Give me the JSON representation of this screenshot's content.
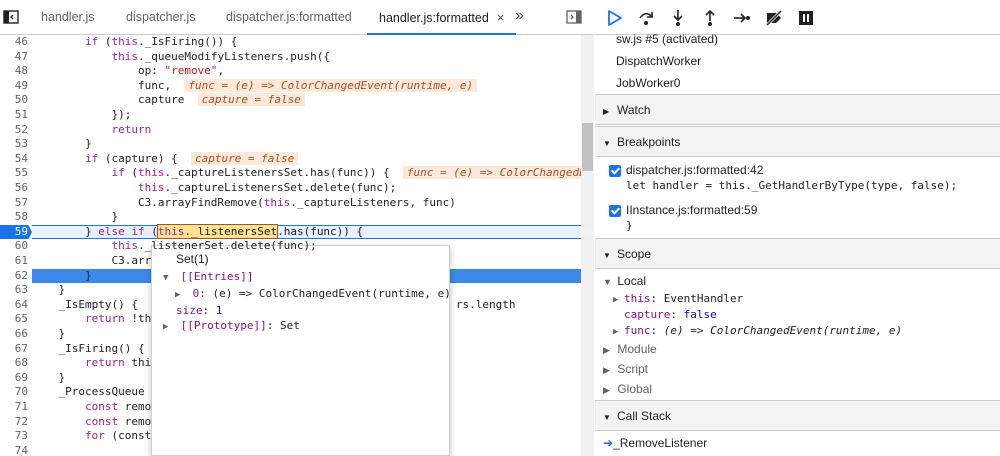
{
  "tabs": [
    {
      "label": "handler.js"
    },
    {
      "label": "dispatcher.js"
    },
    {
      "label": "dispatcher.js:formatted"
    },
    {
      "label": "handler.js:formatted",
      "active": true,
      "close": "×"
    }
  ],
  "more_tabs_glyph": "»",
  "code": {
    "active_line": 59,
    "lines": [
      {
        "n": "46",
        "html": "        <span class=\"kw\">if</span> (<span class=\"kw\">this</span>._IsFiring()) {"
      },
      {
        "n": "47",
        "html": "            <span class=\"kw\">this</span>._queueModifyListeners.push({"
      },
      {
        "n": "48",
        "html": "                op: <span class=\"str\">\"remove\"</span>,"
      },
      {
        "n": "49",
        "html": "                func,  <span class=\"inline-val\">func = (e) =&gt; ColorChangedEvent(runtime, e)</span>"
      },
      {
        "n": "50",
        "html": "                capture  <span class=\"inline-val\">capture = false</span>"
      },
      {
        "n": "51",
        "html": "            });"
      },
      {
        "n": "52",
        "html": "            <span class=\"kw\">return</span>"
      },
      {
        "n": "53",
        "html": "        }"
      },
      {
        "n": "54",
        "html": "        <span class=\"kw\">if</span> (capture) {  <span class=\"inline-val\">capture = false</span>"
      },
      {
        "n": "55",
        "html": "            <span class=\"kw\">if</span> (<span class=\"kw\">this</span>._captureListenersSet.has(func)) {  <span class=\"inline-val\">func = (e) =&gt; ColorChangedEvent(runtime, e)</span>"
      },
      {
        "n": "56",
        "html": "                <span class=\"kw\">this</span>._captureListenersSet.delete(func);"
      },
      {
        "n": "57",
        "html": "                C3.arrayFindRemove(<span class=\"kw\">this</span>._captureListeners, func)"
      },
      {
        "n": "58",
        "html": "            }"
      },
      {
        "n": "59",
        "html": "        } <span class=\"kw\">else</span> <span class=\"kw\">if</span> (<span style=\"background:#fde293;outline:1px solid #a0522d\"><span class=\"kw\">this</span>._listenersSet</span>.has(func)) {"
      },
      {
        "n": "60",
        "html": "            <span class=\"kw\">this</span>._listenerSet.delete(func);"
      },
      {
        "n": "61",
        "html": "            C3.arr"
      },
      {
        "n": "62",
        "html": "        }"
      },
      {
        "n": "63",
        "html": "    }"
      },
      {
        "n": "64",
        "html": "    _IsEmpty() {                                                rs.length"
      },
      {
        "n": "65",
        "html": "        <span class=\"kw\">return</span> !th"
      },
      {
        "n": "66",
        "html": "    }"
      },
      {
        "n": "67",
        "html": "    _IsFiring() {"
      },
      {
        "n": "68",
        "html": "        <span class=\"kw\">return</span> thi"
      },
      {
        "n": "69",
        "html": "    }"
      },
      {
        "n": "70",
        "html": "    _ProcessQueue"
      },
      {
        "n": "71",
        "html": "        <span class=\"kw\">const</span> remo"
      },
      {
        "n": "72",
        "html": "        <span class=\"kw\">const</span> remo"
      },
      {
        "n": "73",
        "html": "        <span class=\"kw\">for</span> (const"
      },
      {
        "n": "74",
        "html": ""
      }
    ]
  },
  "popover": {
    "title": "Set(1)",
    "entries_label": "[[Entries]]",
    "entry_key": "0",
    "entry_value": "(e) => ColorChangedEvent(runtime, e)",
    "size_label": "size",
    "size_value": "1",
    "proto_label": "[[Prototype]]",
    "proto_value": "Set"
  },
  "threads": [
    {
      "label": "sw.js #5 (activated)"
    },
    {
      "label": "DispatchWorker"
    },
    {
      "label": "JobWorker0"
    }
  ],
  "sections": {
    "watch": "Watch",
    "breakpoints": "Breakpoints",
    "scope": "Scope",
    "call_stack": "Call Stack"
  },
  "breakpoints": [
    {
      "file": "dispatcher.js:formatted:42",
      "code": "let handler = this._GetHandlerByType(type, false);",
      "checked": true
    },
    {
      "file": "IInstance.js:formatted:59",
      "code": "}",
      "checked": true
    }
  ],
  "scope": {
    "local_label": "Local",
    "this_key": "this",
    "this_value": "EventHandler",
    "capture_key": "capture",
    "capture_value": "false",
    "func_key": "func",
    "func_value": "(e) => ColorChangedEvent(runtime, e)",
    "module_label": "Module",
    "script_label": "Script",
    "global_label": "Global"
  },
  "call_stack": [
    {
      "label": "_RemoveListener"
    }
  ],
  "colors": {
    "accent": "#1a73e8",
    "highlight": "#fde293",
    "inline_value_bg": "#fde9d9"
  }
}
